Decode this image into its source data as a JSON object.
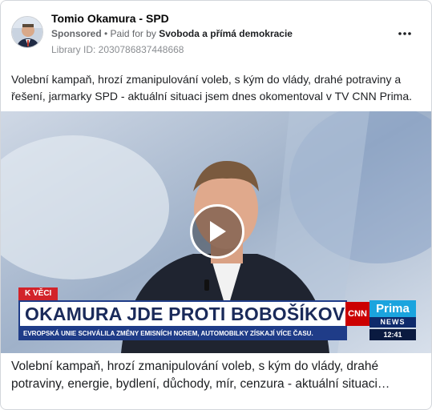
{
  "post": {
    "page_name": "Tomio Okamura - SPD",
    "sponsored_label": "Sponsored",
    "paid_for_prefix": " • Paid for by ",
    "funder": "Svoboda a přímá demokracie",
    "library_id": "Library ID: 2030786837448668",
    "body_text": "Volební kampaň, hrozí zmanipulování voleb, s kým do vlády, drahé potraviny a řešení, jarmarky SPD - aktuální situaci jsem dnes okomentoval v TV CNN Prima.",
    "more_icon": "more-horizontal-icon"
  },
  "video": {
    "segment_label": "K VĚCI",
    "headline": "OKAMURA JDE PROTI BOBOŠÍKOVÉ",
    "ticker": "EVROPSKÁ UNIE SCHVÁLILA ZMĚNY EMISNÍCH NOREM, AUTOMOBILKY ZÍSKAJÍ VÍCE ČASU.",
    "channel_cnn": "CNN",
    "channel_prima": "Prima",
    "channel_news": "NEWS",
    "clock": "12:41",
    "play_icon": "play-icon"
  },
  "caption": {
    "text": "Volební kampaň, hrozí zmanipulování voleb, s kým do vlády, drahé potraviny, energie, bydlení, důchody, mír, cenzura - aktuální situaci…"
  },
  "colors": {
    "headline_blue": "#1f3c88",
    "red_label": "#d2232a",
    "prima_blue": "#1ba4de",
    "text_secondary": "#65676b"
  }
}
